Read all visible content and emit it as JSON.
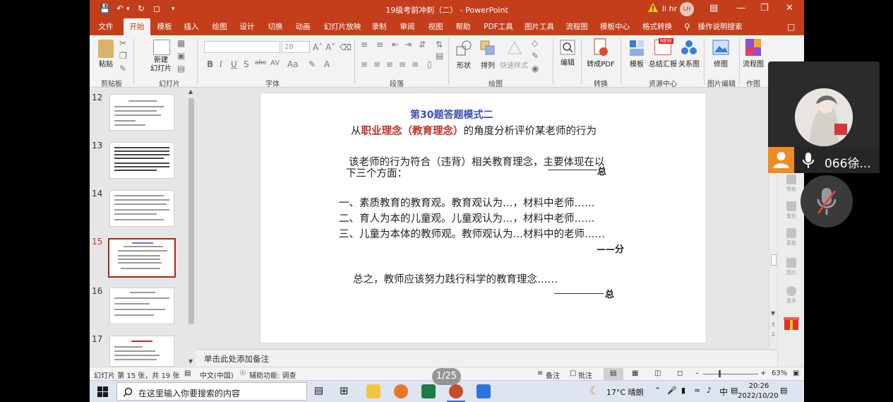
{
  "window": {
    "title": "19级考前冲刺（二） - PowerPoint",
    "user_name": "li hr",
    "user_initials": "LH"
  },
  "tabs": [
    "文件",
    "开始",
    "模板",
    "插入",
    "绘图",
    "设计",
    "切换",
    "动画",
    "幻灯片放映",
    "录制",
    "审阅",
    "视图",
    "帮助",
    "PDF工具",
    "图片工具",
    "流程图",
    "模板中心",
    "格式转换",
    "操作说明搜索"
  ],
  "active_tab": "开始",
  "ribbon": {
    "paste": "粘贴",
    "new_slide": "新建\n幻灯片",
    "font_size": "28",
    "shape": "形状",
    "arrange": "排列",
    "quick_style": "快速样式",
    "edit": "编辑",
    "to_pdf": "转成PDF",
    "template": "模板",
    "summary_report": "总结汇报",
    "relation_chart": "关系图",
    "retouch": "修图",
    "flowchart": "流程图",
    "new_badge": "NEW",
    "groups": {
      "clipboard": "剪贴板",
      "slides": "幻灯片",
      "font": "字体",
      "paragraph": "段落",
      "drawing": "绘图",
      "convert": "转换",
      "resource": "资源中心",
      "image_edit": "图片编辑",
      "works": "作图"
    }
  },
  "thumbnails": [
    {
      "num": "12",
      "selected": false
    },
    {
      "num": "13",
      "selected": false
    },
    {
      "num": "14",
      "selected": false
    },
    {
      "num": "15",
      "selected": true
    },
    {
      "num": "16",
      "selected": false
    },
    {
      "num": "17",
      "selected": false
    }
  ],
  "slide": {
    "title": "第30题答题模式二",
    "sub_prefix": "从",
    "sub_red": "职业理念（教育理念）",
    "sub_suffix": "的角度分析评价某老师的行为",
    "intro_1": "该老师的行为符合（违背）相关教育理念，主要体现在以",
    "intro_2": "下三个方面：",
    "mark_total": "总",
    "point_1": "一、素质教育的教育观。教育观认为…，材料中老师……",
    "point_2": "二、育人为本的儿童观。儿童观认为…，材料中老师……",
    "point_3": "三、儿童为本体的教师观。教师观认为…材料中的老师……",
    "mark_split": "——分",
    "conclusion": "总之，教师应该努力践行科学的教育理念……",
    "mark_total_2": "总"
  },
  "notes_placeholder": "单击此处添加备注",
  "side_labels": [
    "帮助",
    "策划",
    "更新",
    "图示",
    "更多"
  ],
  "status": {
    "slide_info": "幻灯片 第 15 张，共 19 张",
    "language": "中文(中国)",
    "accessibility": "辅助功能: 调查",
    "notes_btn": "备注",
    "comments_btn": "批注",
    "zoom": "63%"
  },
  "page_badge": "1/25",
  "taskbar": {
    "search_placeholder": "在这里输入你要搜索的内容",
    "weather": "17°C 晴朗",
    "ime": "中",
    "time": "20:26",
    "date": "2022/10/20"
  },
  "meeting": {
    "participant": "066徐..."
  },
  "colors": {
    "accent": "#c43e1c",
    "title_blue": "#3d4fb3",
    "emphasis_red": "#c0302a"
  }
}
